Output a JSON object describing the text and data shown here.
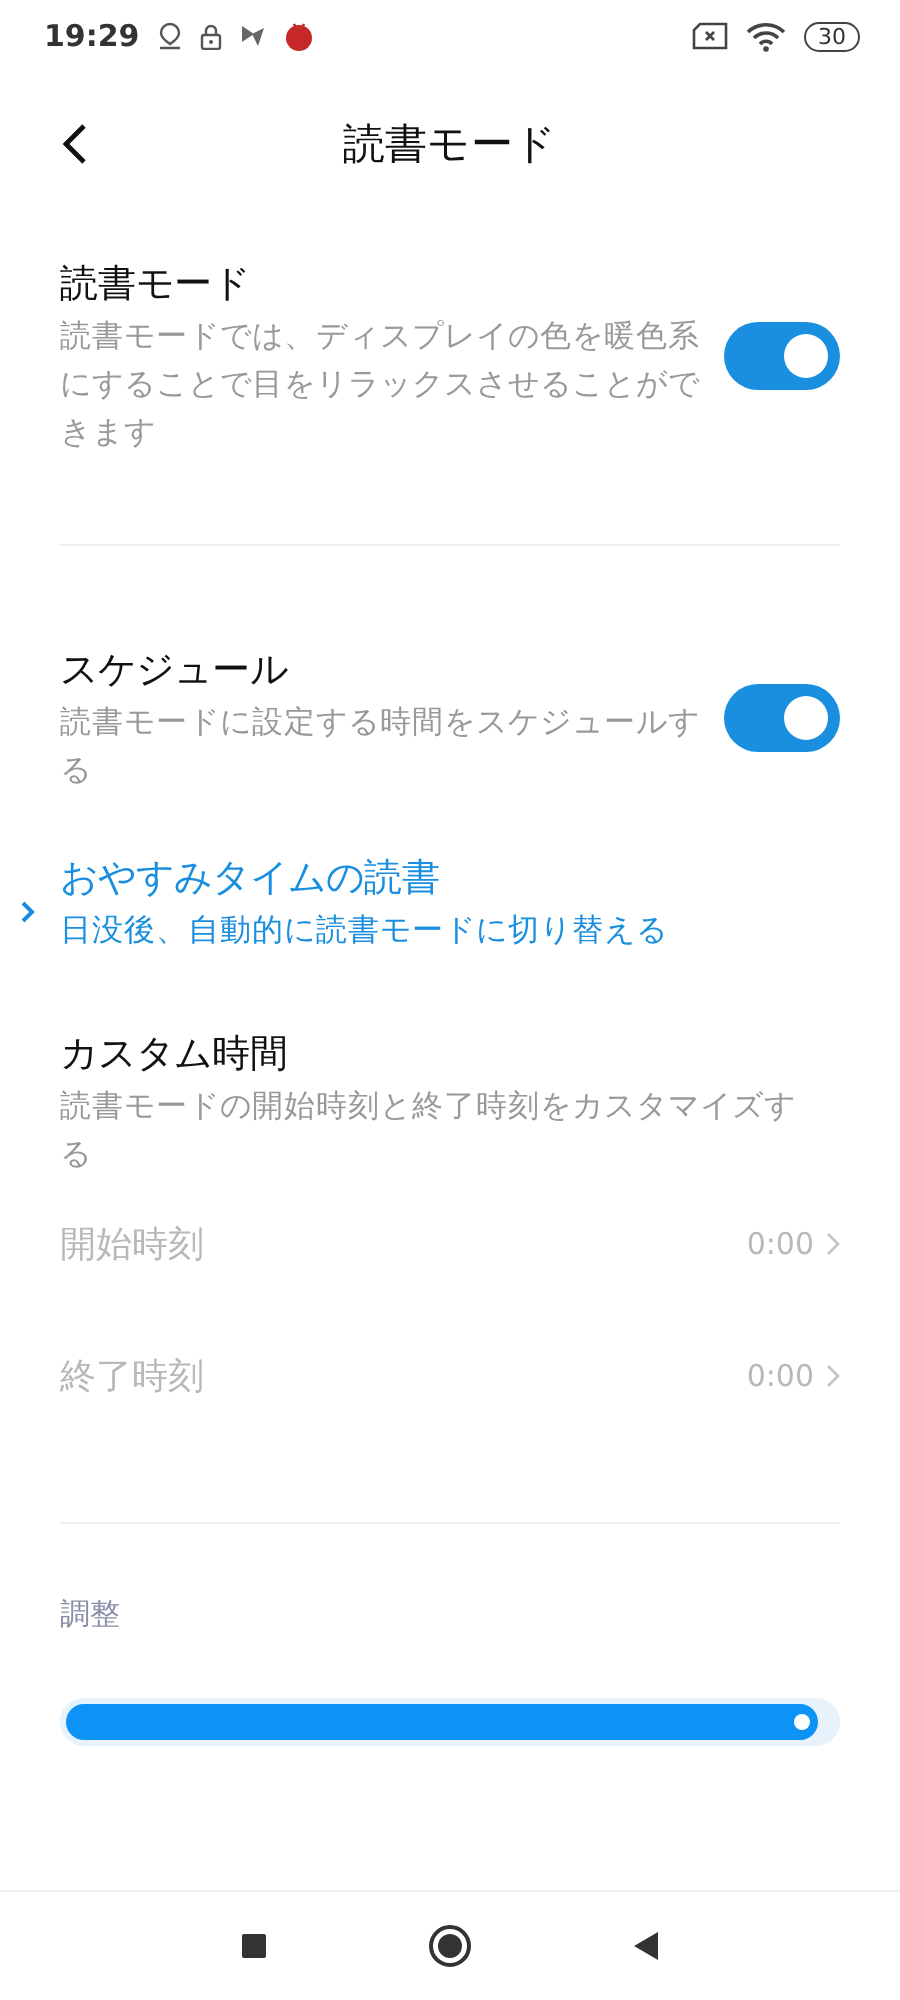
{
  "status_bar": {
    "time": "19:29",
    "battery": "30"
  },
  "header": {
    "title": "読書モード"
  },
  "sections": [
    {
      "items": [
        {
          "kind": "toggle",
          "title": "読書モード",
          "description": "読書モードでは、ディスプレイの色を暖色系にすることで目をリラックスさせることができます",
          "on": true
        }
      ]
    },
    {
      "items": [
        {
          "kind": "toggle",
          "title": "スケジュール",
          "description": "読書モードに設定する時間をスケジュールする",
          "on": true
        },
        {
          "kind": "link",
          "title": "おやすみタイムの読書",
          "description": "日没後、自動的に読書モードに切り替える",
          "selected": true
        },
        {
          "kind": "text",
          "title": "カスタム時間",
          "description": "読書モードの開始時刻と終了時刻をカスタマイズする"
        },
        {
          "kind": "value",
          "title": "開始時刻",
          "value": "0:00",
          "disabled": true
        },
        {
          "kind": "value",
          "title": "終了時刻",
          "value": "0:00",
          "disabled": true
        }
      ]
    },
    {
      "title": "調整",
      "items": [
        {
          "kind": "slider",
          "level": 0.98
        }
      ]
    }
  ]
}
